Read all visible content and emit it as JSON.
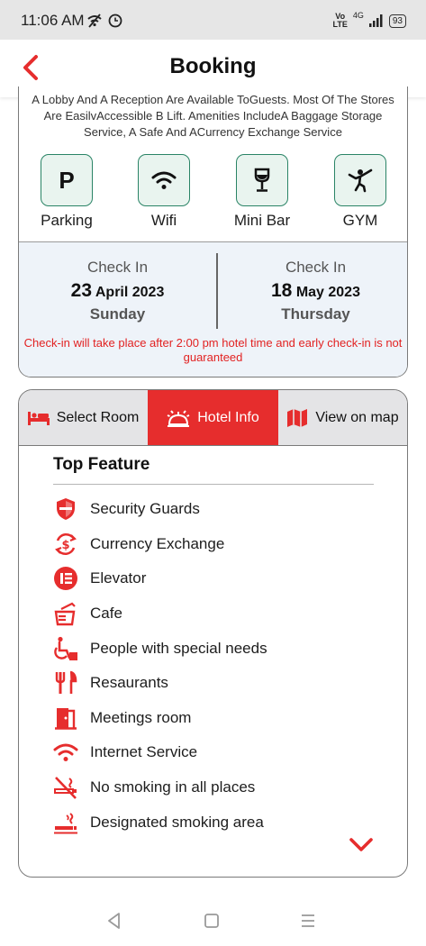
{
  "status_bar": {
    "time": "11:06 AM",
    "network": "4G",
    "volte_top": "Vo",
    "volte_bottom": "LTE",
    "battery": "93"
  },
  "header": {
    "title": "Booking"
  },
  "hotel": {
    "description": "A Lobby And A Reception Are Available ToGuests. Most Of The Stores Are EasilvAccessible B Lift. Amenities IncludeA Baggage Storage Service, A Safe And ACurrency Exchange Service",
    "amenities": [
      {
        "label": "Parking",
        "icon": "parking-icon"
      },
      {
        "label": "Wifi",
        "icon": "wifi-icon"
      },
      {
        "label": "Mini Bar",
        "icon": "wine-glass-icon"
      },
      {
        "label": "GYM",
        "icon": "gym-icon"
      }
    ]
  },
  "check_in": {
    "label": "Check In",
    "day_num": "23",
    "month_year": "April 2023",
    "weekday": "Sunday"
  },
  "check_out": {
    "label": "Check In",
    "day_num": "18",
    "month_year": "May 2023",
    "weekday": "Thursday"
  },
  "checkin_note": "Check-in will take place after 2:00 pm hotel time and early check-in is not  guaranteed",
  "tabs": [
    {
      "label": "Select Room",
      "icon": "bed-icon",
      "active": false
    },
    {
      "label": "Hotel Info",
      "icon": "bell-icon",
      "active": true
    },
    {
      "label": "View on map",
      "icon": "map-icon",
      "active": false
    }
  ],
  "top_feature": {
    "title": "Top Feature",
    "items": [
      {
        "label": "Security Guards",
        "icon": "shield-icon"
      },
      {
        "label": "Currency Exchange",
        "icon": "currency-exchange-icon"
      },
      {
        "label": "Elevator",
        "icon": "elevator-icon"
      },
      {
        "label": "Cafe",
        "icon": "cafe-icon"
      },
      {
        "label": "People with special needs",
        "icon": "accessibility-icon"
      },
      {
        "label": "Resaurants",
        "icon": "restaurant-icon"
      },
      {
        "label": "Meetings room",
        "icon": "meeting-room-icon"
      },
      {
        "label": "Internet Service",
        "icon": "wifi-icon"
      },
      {
        "label": "No smoking in all places",
        "icon": "no-smoking-icon"
      },
      {
        "label": "Designated smoking area",
        "icon": "smoking-area-icon"
      }
    ]
  },
  "colors": {
    "accent": "#e62d2d",
    "amenity_border": "#2a8466",
    "amenity_bg": "#e9f4ef",
    "checkin_bg": "#eef3f9",
    "tab_bg": "#e4e4e6"
  }
}
